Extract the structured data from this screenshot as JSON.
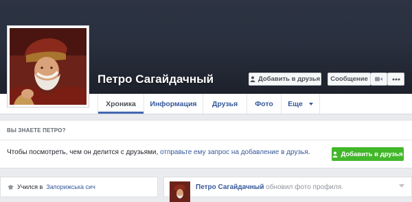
{
  "profile": {
    "name": "Петро Сагайдачный"
  },
  "cover_buttons": {
    "add_friend": "Добавить в друзья",
    "message": "Сообщение",
    "video_icon": "video-camera-icon",
    "more_icon": "more-dots-icon"
  },
  "tabs": [
    {
      "label": "Хроника",
      "active": true
    },
    {
      "label": "Информация"
    },
    {
      "label": "Друзья"
    },
    {
      "label": "Фото"
    },
    {
      "label": "Еще"
    }
  ],
  "know_card": {
    "header": "ВЫ ЗНАЕТЕ ПЕТРО?",
    "text_prefix": "Чтобы посмотреть, чем он делится с друзьями, ",
    "text_link": "отправьте ему запрос на добавление в друзья",
    "text_suffix": ".",
    "button_label": "Добавить в друзья"
  },
  "intro": {
    "studied_prefix": "Учился в",
    "studied_place": "Запорижська сич"
  },
  "post": {
    "author": "Петро Сагайдачный",
    "action": "обновил фото профиля."
  },
  "colors": {
    "cover": "#262c3a",
    "link": "#365899",
    "green_button": "#42b72a",
    "background": "#e9ebee"
  }
}
